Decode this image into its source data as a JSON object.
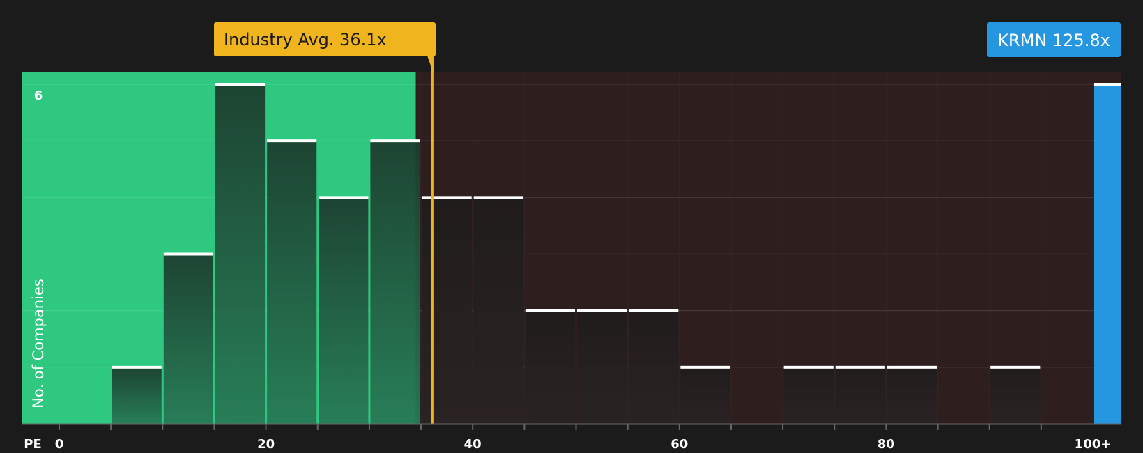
{
  "chart_data": {
    "type": "bar",
    "xlabel": "PE",
    "ylabel": "No. of Companies",
    "ylim": [
      0,
      6.15
    ],
    "xlim": [
      0,
      102.5
    ],
    "y_tick_labels": [
      {
        "value": 6,
        "label": "6"
      }
    ],
    "x_tick_labels": [
      {
        "value": 0,
        "label": "0"
      },
      {
        "value": 20,
        "label": "20"
      },
      {
        "value": 40,
        "label": "40"
      },
      {
        "value": 60,
        "label": "60"
      },
      {
        "value": 80,
        "label": "80"
      },
      {
        "value": 100,
        "label": "100+"
      }
    ],
    "x_minor_ticks": [
      0,
      5,
      10,
      15,
      20,
      25,
      30,
      35,
      40,
      45,
      50,
      55,
      60,
      65,
      70,
      75,
      80,
      85,
      90,
      95
    ],
    "gridlines_y": [
      1,
      2,
      3,
      4,
      5,
      6
    ],
    "bins": [
      {
        "x0": 5,
        "x1": 10,
        "count": 1
      },
      {
        "x0": 10,
        "x1": 15,
        "count": 3
      },
      {
        "x0": 15,
        "x1": 20,
        "count": 6
      },
      {
        "x0": 20,
        "x1": 25,
        "count": 5
      },
      {
        "x0": 25,
        "x1": 30,
        "count": 4
      },
      {
        "x0": 30,
        "x1": 35,
        "count": 5
      },
      {
        "x0": 35,
        "x1": 40,
        "count": 4
      },
      {
        "x0": 40,
        "x1": 45,
        "count": 4
      },
      {
        "x0": 45,
        "x1": 50,
        "count": 2
      },
      {
        "x0": 50,
        "x1": 55,
        "count": 2
      },
      {
        "x0": 55,
        "x1": 60,
        "count": 2
      },
      {
        "x0": 60,
        "x1": 65,
        "count": 1
      },
      {
        "x0": 70,
        "x1": 75,
        "count": 1
      },
      {
        "x0": 75,
        "x1": 80,
        "count": 1
      },
      {
        "x0": 80,
        "x1": 85,
        "count": 1
      },
      {
        "x0": 90,
        "x1": 95,
        "count": 1
      }
    ],
    "subject": {
      "ticker": "KRMN",
      "value": 125.8,
      "label": "KRMN 125.8x",
      "count": 6
    },
    "industry_avg": {
      "value": 36.1,
      "label": "Industry Avg. 36.1x"
    },
    "fair_zone_max": 34.5,
    "grid": true,
    "colors": {
      "background": "#1b1b1b",
      "good_zone": "#2ec880",
      "bad_zone": "#2e1e1e",
      "bar_good": "#1e4a36",
      "bar_bad": "#252020",
      "bar_cap": "#ffffff",
      "avg_line": "#f0b41e",
      "subject_bar": "#2596e0",
      "gridline": "#4a4141",
      "axis": "#666666"
    }
  }
}
